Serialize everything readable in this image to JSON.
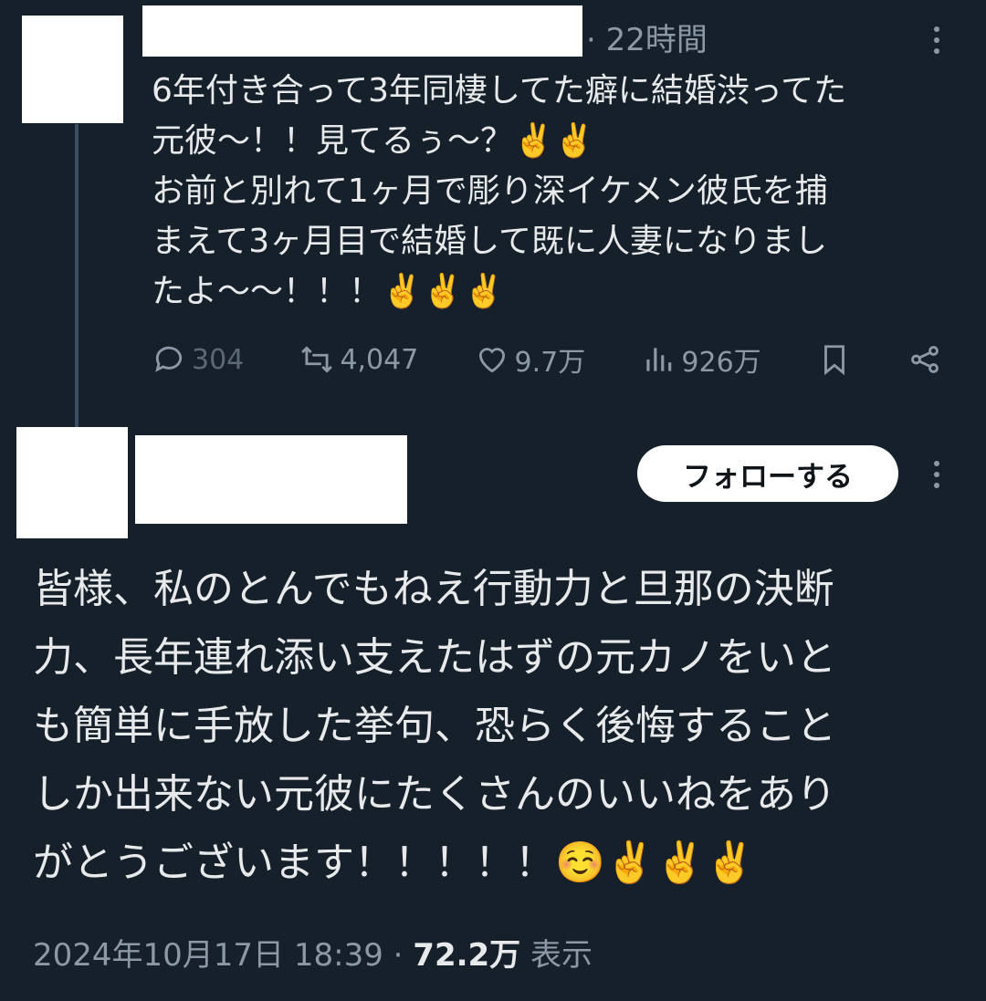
{
  "post1": {
    "time": "· 22時間",
    "text": "6年付き合って3年同棲してた癖に結婚渋ってた\n元彼〜！！見てるぅ〜？✌️✌️\nお前と別れて1ヶ月で彫り深イケメン彼氏を捕\nまえて3ヶ月目で結婚して既に人妻になりまし\nたよ〜〜！！！✌️✌️✌️",
    "stats": {
      "replies": "304",
      "reposts": "4,047",
      "likes": "9.7万",
      "views": "926万"
    },
    "icons": [
      "reply-icon",
      "repost-icon",
      "like-icon",
      "views-icon",
      "bookmark-icon",
      "share-icon",
      "more-icon"
    ]
  },
  "post2": {
    "follow_label": "フォローする",
    "text": "皆様、私のとんでもねえ行動力と旦那の決断\n力、長年連れ添い支えたはずの元カノをいと\nも簡単に手放した挙句、恐らく後悔すること\nしか出来ない元彼にたくさんのいいねをあり\nがとうございます！！！！！☺️✌️✌️✌️",
    "timestamp": "2024年10月17日 18:39",
    "separator": " · ",
    "views_count": "72.2万",
    "views_label": " 表示"
  },
  "colors": {
    "background": "#15202b",
    "text": "#e7e9ea",
    "secondary": "#8b98a5",
    "thread_line": "#3b4f63",
    "follow_bg": "#ffffff"
  }
}
